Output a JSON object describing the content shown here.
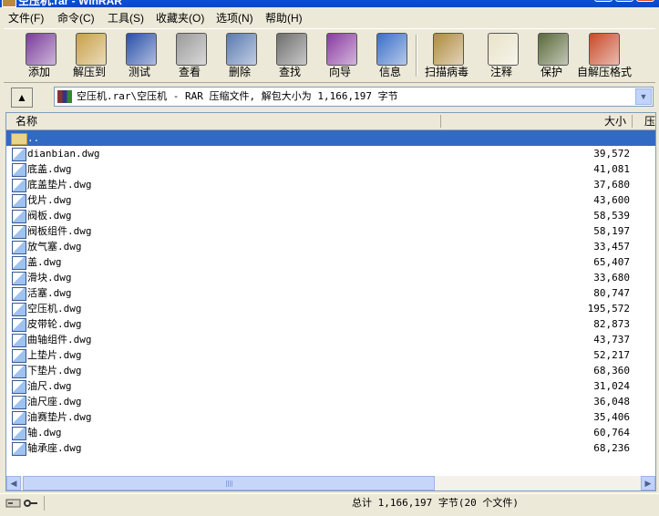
{
  "window": {
    "title": "空压机.rar - WinRAR"
  },
  "menu": [
    "文件(F)",
    "命令(C)",
    "工具(S)",
    "收藏夹(O)",
    "选项(N)",
    "帮助(H)"
  ],
  "toolbar": [
    {
      "label": "添加",
      "icon": "add-archive-icon",
      "color": "#7a3c9a"
    },
    {
      "label": "解压到",
      "icon": "extract-to-icon",
      "color": "#c8a048"
    },
    {
      "label": "测试",
      "icon": "test-icon",
      "color": "#2a4fa8"
    },
    {
      "label": "查看",
      "icon": "view-icon",
      "color": "#9a9a9a"
    },
    {
      "label": "删除",
      "icon": "delete-icon",
      "color": "#5a7ab0"
    },
    {
      "label": "查找",
      "icon": "find-icon",
      "color": "#6e6e6e"
    },
    {
      "label": "向导",
      "icon": "wizard-icon",
      "color": "#8a3aa0"
    },
    {
      "label": "信息",
      "icon": "info-icon",
      "color": "#3a6ec8"
    },
    {
      "label": "扫描病毒",
      "icon": "virus-scan-icon",
      "color": "#b08a40"
    },
    {
      "label": "注释",
      "icon": "comment-icon",
      "color": "#e8e2c8"
    },
    {
      "label": "保护",
      "icon": "protect-icon",
      "color": "#5a6a3a"
    },
    {
      "label": "自解压格式",
      "icon": "sfx-icon",
      "color": "#c84a2a"
    }
  ],
  "address": {
    "text": "空压机.rar\\空压机 - RAR 压缩文件, 解包大小为 1,166,197 字节"
  },
  "columns": {
    "name": "名称",
    "size": "大小",
    "packed": "压"
  },
  "parent_row": "..",
  "files": [
    {
      "name": "dianbian.dwg",
      "size": "39,572"
    },
    {
      "name": "底盖.dwg",
      "size": "41,081"
    },
    {
      "name": "底盖垫片.dwg",
      "size": "37,680"
    },
    {
      "name": "伐片.dwg",
      "size": "43,600"
    },
    {
      "name": "阀板.dwg",
      "size": "58,539"
    },
    {
      "name": "阀板组件.dwg",
      "size": "58,197"
    },
    {
      "name": "放气塞.dwg",
      "size": "33,457"
    },
    {
      "name": "盖.dwg",
      "size": "65,407"
    },
    {
      "name": "滑块.dwg",
      "size": "33,680"
    },
    {
      "name": "活塞.dwg",
      "size": "80,747"
    },
    {
      "name": "空压机.dwg",
      "size": "195,572"
    },
    {
      "name": "皮带轮.dwg",
      "size": "82,873"
    },
    {
      "name": "曲轴组件.dwg",
      "size": "43,737"
    },
    {
      "name": "上垫片.dwg",
      "size": "52,217"
    },
    {
      "name": "下垫片.dwg",
      "size": "68,360"
    },
    {
      "name": "油尺.dwg",
      "size": "31,024"
    },
    {
      "name": "油尺座.dwg",
      "size": "36,048"
    },
    {
      "name": "油赛垫片.dwg",
      "size": "35,406"
    },
    {
      "name": "轴.dwg",
      "size": "60,764"
    },
    {
      "name": "轴承座.dwg",
      "size": "68,236"
    }
  ],
  "status": {
    "total": "总计 1,166,197 字节(20 个文件)"
  }
}
